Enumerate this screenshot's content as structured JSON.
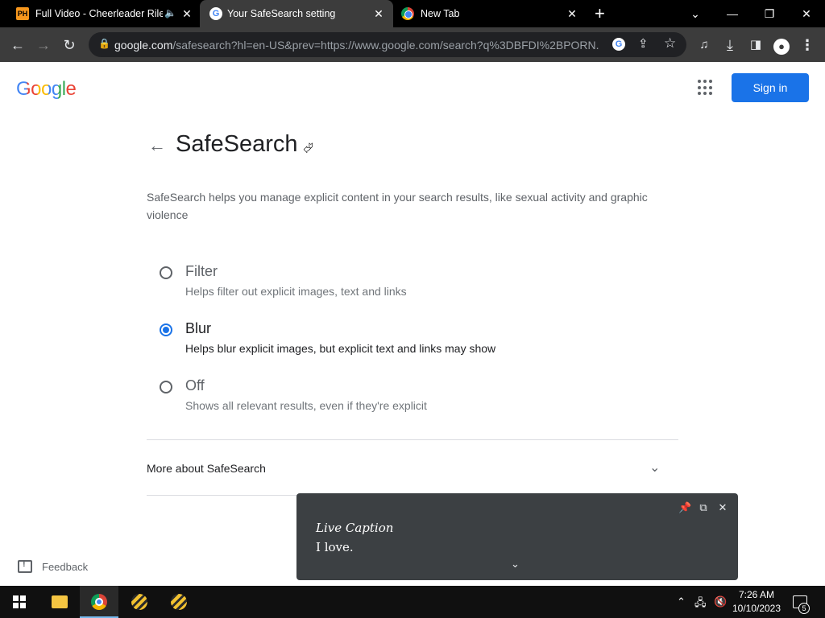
{
  "browser": {
    "tabs": [
      {
        "favicon": "pornhub-icon",
        "title": "Full Video - Cheerleader Rile",
        "audio": true
      },
      {
        "favicon": "google-icon",
        "title": "Your SafeSearch setting",
        "active": true
      },
      {
        "favicon": "chrome-icon",
        "title": "New Tab"
      }
    ],
    "new_tab": "+",
    "url_host": "google.com",
    "url_path": "/safesearch?hl=en-US&prev=https://www.google.com/search?q%3DBFDI%2BPORN..."
  },
  "header": {
    "logo": "Google",
    "signin_label": "Sign in"
  },
  "main": {
    "title": "SafeSearch",
    "description": "SafeSearch helps you manage explicit content in your search results, like sexual activity and graphic violence",
    "options": [
      {
        "label": "Filter",
        "help": "Helps filter out explicit images, text and links",
        "checked": false
      },
      {
        "label": "Blur",
        "help": "Helps blur explicit images, but explicit text and links may show",
        "checked": true
      },
      {
        "label": "Off",
        "help": "Shows all relevant results, even if they're explicit",
        "checked": false
      }
    ],
    "more_about": "More about SafeSearch",
    "feedback_label": "Feedback"
  },
  "live_caption": {
    "title": "Live Caption",
    "text": "I love."
  },
  "taskbar": {
    "time": "7:26 AM",
    "date": "10/10/2023",
    "notification_count": "5"
  },
  "colors": {
    "accent": "#1a73e8",
    "chrome_dark": "#3c3c3c"
  }
}
